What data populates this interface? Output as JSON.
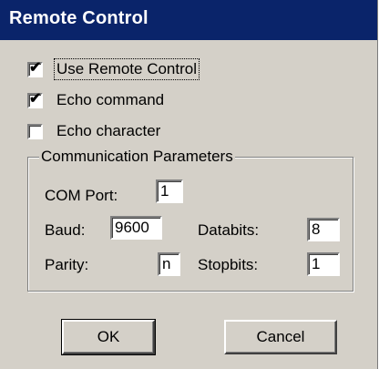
{
  "window": {
    "title": "Remote Control"
  },
  "checkboxes": [
    {
      "label": "Use Remote Control",
      "checked": true,
      "check_glyph": "✔"
    },
    {
      "label": "Echo command",
      "checked": true,
      "check_glyph": "✔"
    },
    {
      "label": "Echo character",
      "checked": false,
      "check_glyph": ""
    }
  ],
  "group": {
    "label": "Communication Parameters",
    "com_port": {
      "label": "COM Port:",
      "value": "1"
    },
    "baud": {
      "label": "Baud:",
      "value": "9600"
    },
    "databits": {
      "label": "Databits:",
      "value": "8"
    },
    "parity": {
      "label": "Parity:",
      "value": "n"
    },
    "stopbits": {
      "label": "Stopbits:",
      "value": "1"
    }
  },
  "buttons": {
    "ok_label": "OK",
    "cancel_label": "Cancel"
  },
  "colors": {
    "title_bar": "#0a246a",
    "dialog_face": "#d4d0c8"
  }
}
